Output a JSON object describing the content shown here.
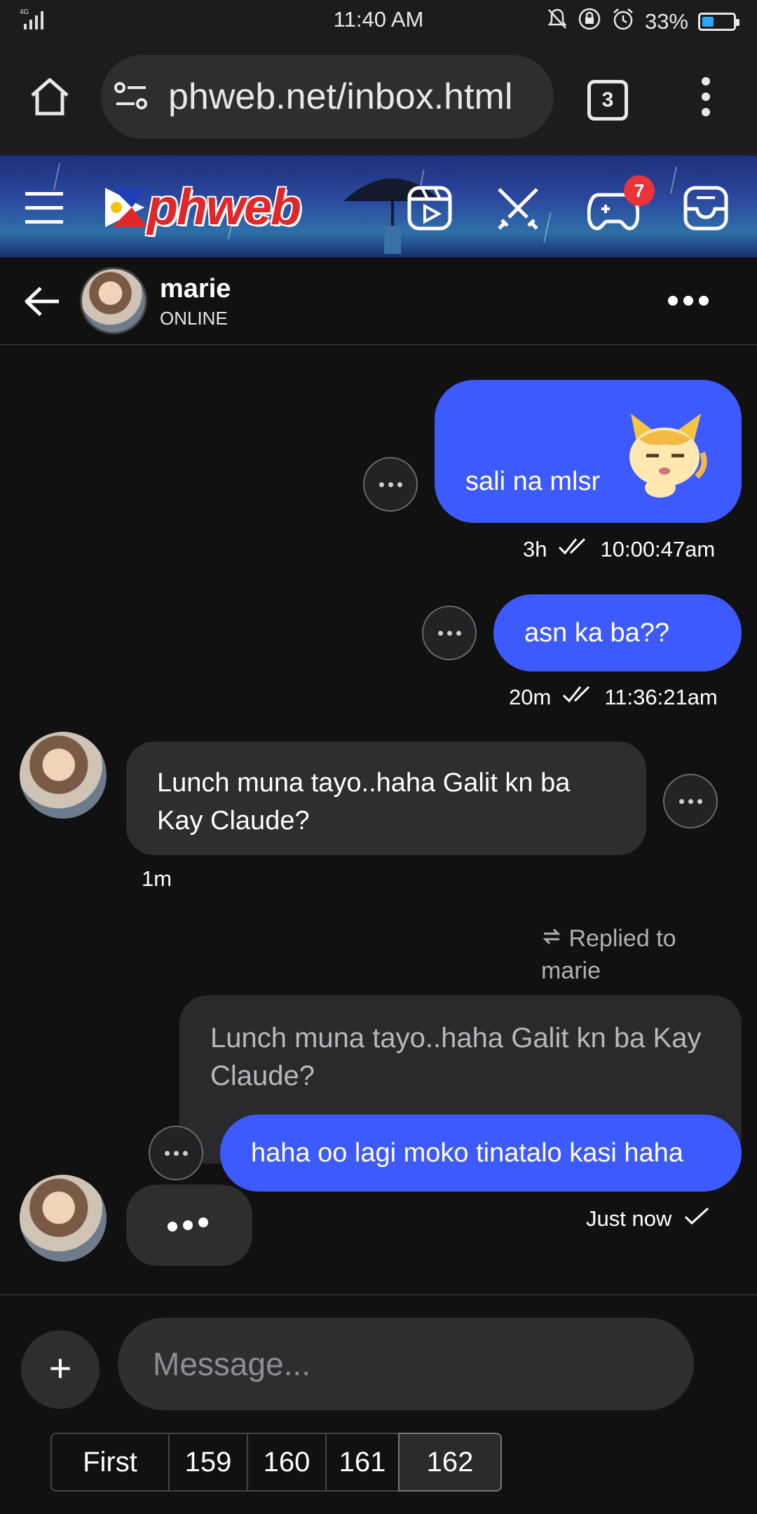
{
  "status_bar": {
    "time": "11:40 AM",
    "network": "4G",
    "battery_percent": "33%",
    "battery_level": 0.33
  },
  "browser": {
    "url": "phweb.net/inbox.html",
    "tab_count": "3"
  },
  "site_header": {
    "logo_text": "phweb",
    "notification_count": "7"
  },
  "chat": {
    "contact_name": "marie",
    "contact_status": "ONLINE"
  },
  "messages": [
    {
      "from": "me",
      "text": "sali na mlsr",
      "age": "3h",
      "time": "10:00:47am",
      "has_sticker": true
    },
    {
      "from": "me",
      "text": "asn ka ba??",
      "age": "20m",
      "time": "11:36:21am"
    },
    {
      "from": "them",
      "text": "Lunch muna tayo..haha Galit kn ba Kay Claude?",
      "age": "1m"
    },
    {
      "from": "me",
      "reply_label": "Replied to marie",
      "quoted": "Lunch muna tayo..haha Galit kn ba Kay Claude?",
      "text": "haha oo lagi moko tinatalo kasi haha",
      "age": "Just now"
    }
  ],
  "composer": {
    "placeholder": "Message...",
    "plus_label": "+"
  },
  "pagination": [
    "First",
    "159",
    "160",
    "161",
    "162"
  ],
  "colors": {
    "bubble_me": "#3d5afe",
    "bubble_them": "#2e2e31",
    "background": "#111112",
    "badge": "#e8333a"
  }
}
